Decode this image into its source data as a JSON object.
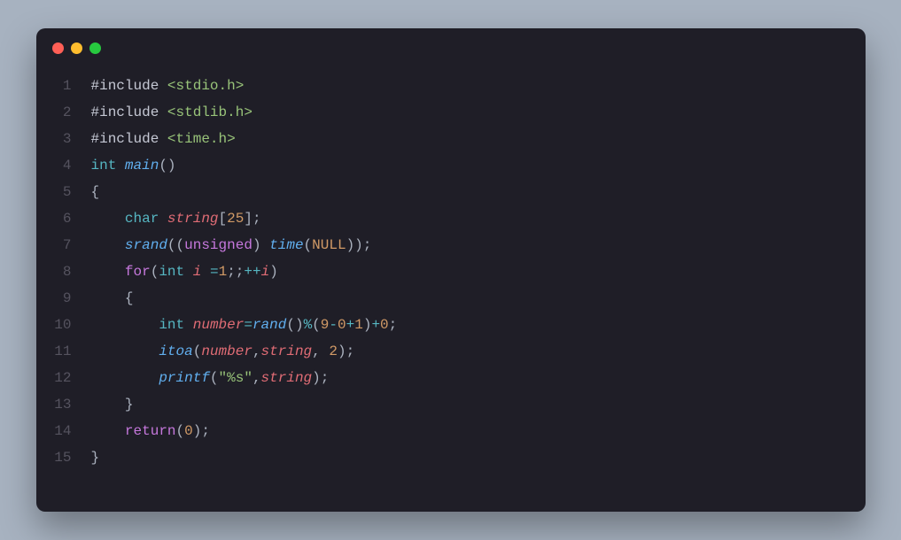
{
  "window": {
    "traffic_lights": [
      "close",
      "minimize",
      "zoom"
    ]
  },
  "editor": {
    "lines": [
      {
        "num": "1",
        "tokens": [
          {
            "t": "#include ",
            "c": "tok-preproc"
          },
          {
            "t": "<stdio.h>",
            "c": "tok-str"
          }
        ]
      },
      {
        "num": "2",
        "tokens": [
          {
            "t": "#include ",
            "c": "tok-preproc"
          },
          {
            "t": "<stdlib.h>",
            "c": "tok-str"
          }
        ]
      },
      {
        "num": "3",
        "tokens": [
          {
            "t": "#include ",
            "c": "tok-preproc"
          },
          {
            "t": "<time.h>",
            "c": "tok-str"
          }
        ]
      },
      {
        "num": "4",
        "tokens": [
          {
            "t": "int",
            "c": "tok-type"
          },
          {
            "t": " ",
            "c": "tok-plain"
          },
          {
            "t": "main",
            "c": "tok-func"
          },
          {
            "t": "()",
            "c": "tok-punc"
          }
        ]
      },
      {
        "num": "5",
        "tokens": [
          {
            "t": "{",
            "c": "tok-punc"
          }
        ]
      },
      {
        "num": "6",
        "tokens": [
          {
            "t": "    ",
            "c": "tok-plain"
          },
          {
            "t": "char",
            "c": "tok-type"
          },
          {
            "t": " ",
            "c": "tok-plain"
          },
          {
            "t": "string",
            "c": "tok-ident"
          },
          {
            "t": "[",
            "c": "tok-punc"
          },
          {
            "t": "25",
            "c": "tok-num"
          },
          {
            "t": "];",
            "c": "tok-punc"
          }
        ]
      },
      {
        "num": "7",
        "tokens": [
          {
            "t": "    ",
            "c": "tok-plain"
          },
          {
            "t": "srand",
            "c": "tok-func"
          },
          {
            "t": "((",
            "c": "tok-punc"
          },
          {
            "t": "unsigned",
            "c": "tok-kw"
          },
          {
            "t": ") ",
            "c": "tok-punc"
          },
          {
            "t": "time",
            "c": "tok-func"
          },
          {
            "t": "(",
            "c": "tok-punc"
          },
          {
            "t": "NULL",
            "c": "tok-const"
          },
          {
            "t": "));",
            "c": "tok-punc"
          }
        ]
      },
      {
        "num": "8",
        "tokens": [
          {
            "t": "    ",
            "c": "tok-plain"
          },
          {
            "t": "for",
            "c": "tok-kw"
          },
          {
            "t": "(",
            "c": "tok-punc"
          },
          {
            "t": "int",
            "c": "tok-type"
          },
          {
            "t": " ",
            "c": "tok-plain"
          },
          {
            "t": "i",
            "c": "tok-ident"
          },
          {
            "t": " ",
            "c": "tok-plain"
          },
          {
            "t": "=",
            "c": "tok-op"
          },
          {
            "t": "1",
            "c": "tok-num"
          },
          {
            "t": ";;",
            "c": "tok-punc"
          },
          {
            "t": "++",
            "c": "tok-op"
          },
          {
            "t": "i",
            "c": "tok-ident"
          },
          {
            "t": ")",
            "c": "tok-punc"
          }
        ]
      },
      {
        "num": "9",
        "tokens": [
          {
            "t": "    {",
            "c": "tok-punc"
          }
        ]
      },
      {
        "num": "10",
        "tokens": [
          {
            "t": "        ",
            "c": "tok-plain"
          },
          {
            "t": "int",
            "c": "tok-type"
          },
          {
            "t": " ",
            "c": "tok-plain"
          },
          {
            "t": "number",
            "c": "tok-ident"
          },
          {
            "t": "=",
            "c": "tok-op"
          },
          {
            "t": "rand",
            "c": "tok-func"
          },
          {
            "t": "()",
            "c": "tok-punc"
          },
          {
            "t": "%",
            "c": "tok-op"
          },
          {
            "t": "(",
            "c": "tok-punc"
          },
          {
            "t": "9",
            "c": "tok-num"
          },
          {
            "t": "-",
            "c": "tok-op"
          },
          {
            "t": "0",
            "c": "tok-num"
          },
          {
            "t": "+",
            "c": "tok-op"
          },
          {
            "t": "1",
            "c": "tok-num"
          },
          {
            "t": ")",
            "c": "tok-punc"
          },
          {
            "t": "+",
            "c": "tok-op"
          },
          {
            "t": "0",
            "c": "tok-num"
          },
          {
            "t": ";",
            "c": "tok-punc"
          }
        ]
      },
      {
        "num": "11",
        "tokens": [
          {
            "t": "        ",
            "c": "tok-plain"
          },
          {
            "t": "itoa",
            "c": "tok-func"
          },
          {
            "t": "(",
            "c": "tok-punc"
          },
          {
            "t": "number",
            "c": "tok-ident"
          },
          {
            "t": ",",
            "c": "tok-punc"
          },
          {
            "t": "string",
            "c": "tok-ident"
          },
          {
            "t": ", ",
            "c": "tok-punc"
          },
          {
            "t": "2",
            "c": "tok-num"
          },
          {
            "t": ");",
            "c": "tok-punc"
          }
        ]
      },
      {
        "num": "12",
        "tokens": [
          {
            "t": "        ",
            "c": "tok-plain"
          },
          {
            "t": "printf",
            "c": "tok-func"
          },
          {
            "t": "(",
            "c": "tok-punc"
          },
          {
            "t": "\"%s\"",
            "c": "tok-str"
          },
          {
            "t": ",",
            "c": "tok-punc"
          },
          {
            "t": "string",
            "c": "tok-ident"
          },
          {
            "t": ");",
            "c": "tok-punc"
          }
        ]
      },
      {
        "num": "13",
        "tokens": [
          {
            "t": "    }",
            "c": "tok-punc"
          }
        ]
      },
      {
        "num": "14",
        "tokens": [
          {
            "t": "    ",
            "c": "tok-plain"
          },
          {
            "t": "return",
            "c": "tok-kw"
          },
          {
            "t": "(",
            "c": "tok-punc"
          },
          {
            "t": "0",
            "c": "tok-num"
          },
          {
            "t": ");",
            "c": "tok-punc"
          }
        ]
      },
      {
        "num": "15",
        "tokens": [
          {
            "t": "}",
            "c": "tok-punc"
          }
        ]
      }
    ]
  }
}
